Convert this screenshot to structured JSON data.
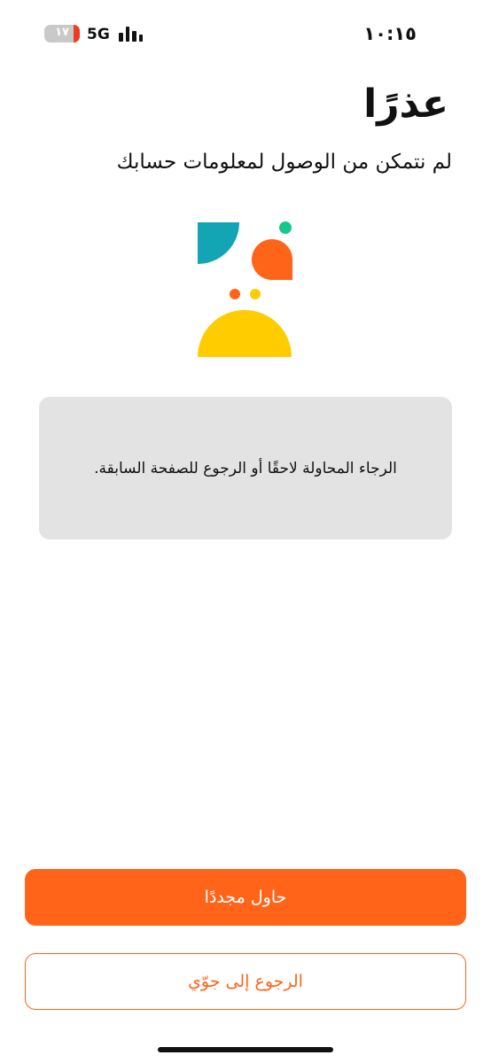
{
  "status_bar": {
    "time": "١٠:١٥",
    "battery_label": "١٧",
    "battery_level": 0.17,
    "network": "5G"
  },
  "error": {
    "title": "عذرًا",
    "subtitle": "لم نتمكن من الوصول لمعلومات حسابك",
    "message": "الرجاء المحاولة لاحقًا أو الرجوع للصفحة السابقة."
  },
  "actions": {
    "retry_label": "حاول مجددًا",
    "back_label": "الرجوع إلى جوّي"
  },
  "colors": {
    "primary": "#ff6419",
    "message_bg": "#e2e3e2",
    "teal": "#13a5b3",
    "green": "#14c98a",
    "orange": "#ff6419",
    "yellow": "#ffcc00"
  }
}
